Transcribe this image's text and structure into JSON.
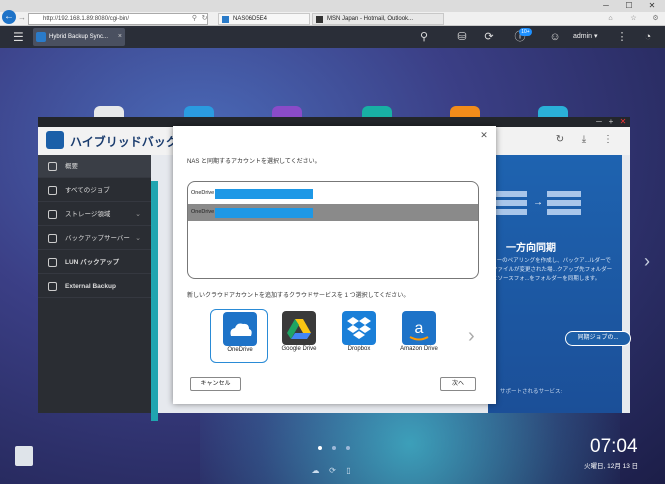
{
  "browser": {
    "address": "http://192.168.1.89:8080/cgi-bin/",
    "tabs": [
      {
        "label": "NAS06D5E4"
      },
      {
        "label": "MSN Japan - Hotmail, Outlook..."
      }
    ]
  },
  "qts": {
    "app_tab": "Hybrid Backup Sync...",
    "notification_count": "10+",
    "user": "admin"
  },
  "app": {
    "title": "ハイブリッドバックア",
    "sidebar": [
      {
        "label": "概要"
      },
      {
        "label": "すべてのジョブ"
      },
      {
        "label": "ストレージ領域"
      },
      {
        "label": "バックアップサーバー"
      },
      {
        "label": "LUN バックアップ"
      },
      {
        "label": "External Backup"
      }
    ],
    "hero": {
      "title": "一方向同期",
      "desc": "...ーのペアリングを作成し、バックア...ルダーでファイルが変更された場...クアップ先フォルダーとソースフォ...をフォルダーを同期します。",
      "button": "同期ジョブの...",
      "footer": "サポートされるサービス:"
    }
  },
  "dialog": {
    "prompt": "NAS と同期するアカウントを選択してください。",
    "accounts": [
      {
        "prefix": "OneDrive",
        "selected": false
      },
      {
        "prefix": "OneDrive",
        "selected": true
      }
    ],
    "add_prompt": "新しいクラウドアカウントを追加するクラウドサービスを 1 つ選択してください。",
    "services": [
      {
        "label": "OneDrive",
        "selected": true
      },
      {
        "label": "Google Drive",
        "selected": false
      },
      {
        "label": "Dropbox",
        "selected": false
      },
      {
        "label": "Amazon Drive",
        "selected": false
      }
    ],
    "cancel": "キャンセル",
    "next": "次へ"
  },
  "desktop": {
    "time": "07:04",
    "date": "火曜日, 12月 13 日"
  }
}
